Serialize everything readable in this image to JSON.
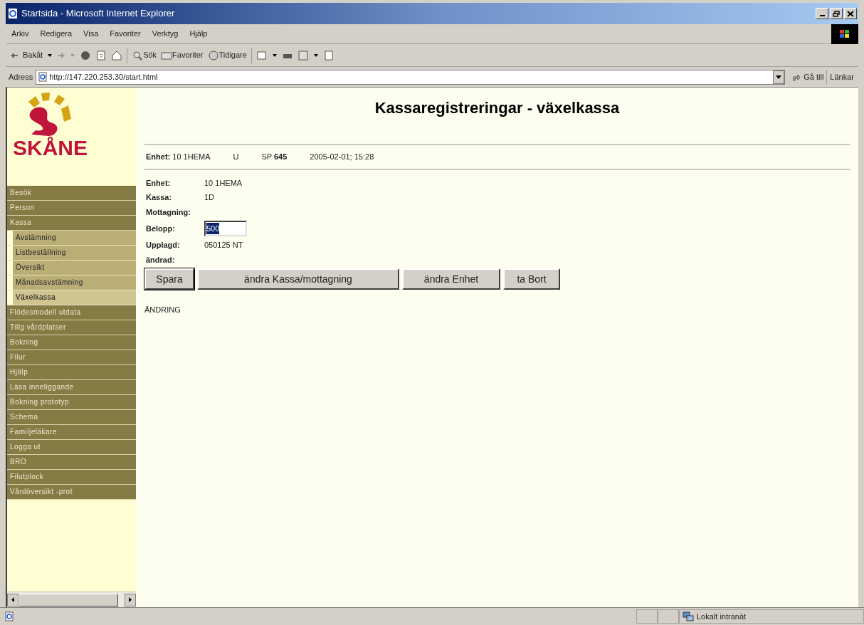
{
  "window": {
    "title": "Startsida - Microsoft Internet Explorer"
  },
  "menu": [
    "Arkiv",
    "Redigera",
    "Visa",
    "Favoriter",
    "Verktyg",
    "Hjälp"
  ],
  "toolbar": {
    "back": "Bakåt",
    "search": "Sök",
    "favorites": "Favoriter",
    "history": "Tidigare"
  },
  "address": {
    "label": "Adress",
    "value": "http://147.220.253.30/start.html",
    "go": "Gå till",
    "links": "Länkar"
  },
  "logo": {
    "text": "SKÅNE"
  },
  "sidebar": {
    "items": [
      {
        "label": "Besök",
        "selected": false
      },
      {
        "label": "Person",
        "selected": false
      },
      {
        "label": "Kassa",
        "selected": false,
        "children": [
          {
            "label": "Avstämning",
            "selected": false
          },
          {
            "label": "Listbeställning",
            "selected": false
          },
          {
            "label": "Översikt",
            "selected": false
          },
          {
            "label": "Månadsavstämning",
            "selected": false
          },
          {
            "label": "Växelkassa",
            "selected": true
          }
        ]
      },
      {
        "label": "Flödesmodell utdata",
        "selected": false
      },
      {
        "label": "Tillg vårdplatser",
        "selected": false
      },
      {
        "label": "Bokning",
        "selected": false
      },
      {
        "label": "Filur",
        "selected": false
      },
      {
        "label": "Hjälp",
        "selected": false
      },
      {
        "label": "Läsa inneliggande",
        "selected": false
      },
      {
        "label": "Bokning prototyp",
        "selected": false
      },
      {
        "label": "Schema",
        "selected": false
      },
      {
        "label": "Familjeläkare",
        "selected": false
      },
      {
        "label": "Logga ut",
        "selected": false
      },
      {
        "label": "BRO",
        "selected": false
      },
      {
        "label": "Filutplock",
        "selected": false
      },
      {
        "label": "Vårdöversikt -prot",
        "selected": false
      }
    ]
  },
  "page": {
    "title": "Kassaregistreringar - växelkassa",
    "header": [
      {
        "label": "Enhet:",
        "value": "10 1HEMA"
      },
      {
        "value": "U"
      },
      {
        "value": "SP **645**"
      },
      {
        "value": "2005-02-01; 15:28"
      }
    ],
    "fields": [
      {
        "kind": "text",
        "label": "Enhet:",
        "value": "10 1HEMA"
      },
      {
        "kind": "text",
        "label": "Kassa:",
        "value": "1D"
      },
      {
        "kind": "text",
        "label": "Mottagning:"
      },
      {
        "kind": "input",
        "label": "Belopp:",
        "value": "500"
      },
      {
        "kind": "text",
        "label": "Upplagd:",
        "value": "050125 NT"
      },
      {
        "kind": "text",
        "label": "ändrad:"
      }
    ],
    "buttons": [
      "Spara",
      "ändra Kassa/mottagning",
      "ändra Enhet",
      "ta Bort"
    ],
    "status_text": "ÄNDRING"
  },
  "status_bar": {
    "zone": "Lokalt intranät"
  }
}
